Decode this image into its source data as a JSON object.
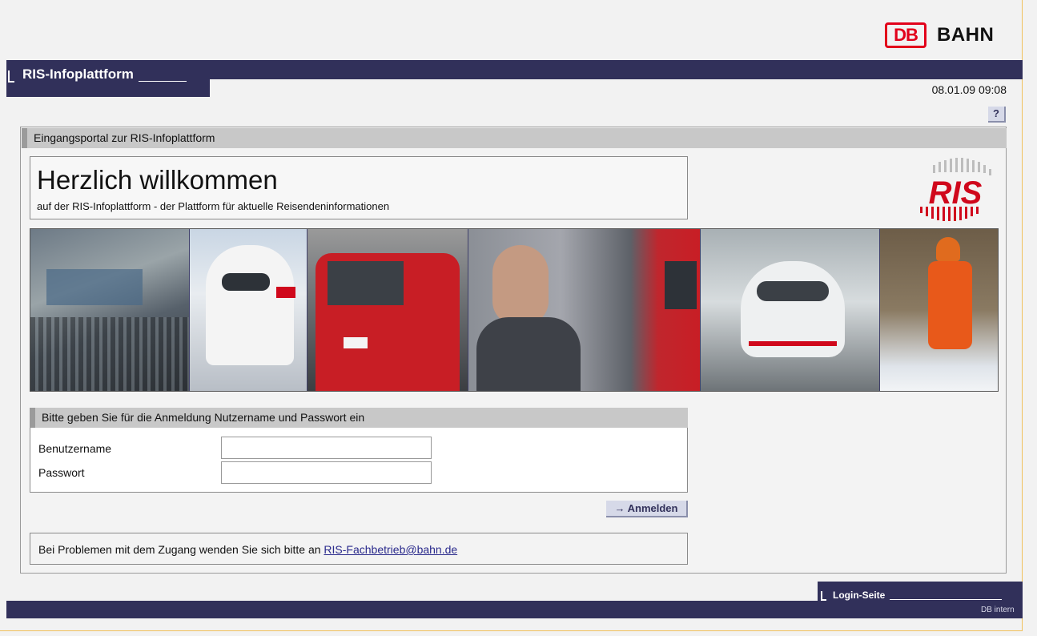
{
  "brand": {
    "logo_box": "DB",
    "logo_text": "BAHN",
    "logo_color": "#e2001a"
  },
  "header": {
    "app_title": "RIS-Infoplattform",
    "datetime": "08.01.09 09:08",
    "help_label": "?",
    "bar_color": "#31305a"
  },
  "main": {
    "panel_title": "Eingangsportal zur RIS-Infoplattform",
    "welcome_heading": "Herzlich willkommen",
    "welcome_subtitle": "auf der RIS-Infoplattform - der Plattform für aktuelle Reisendeninformationen",
    "ris_logo_text": "RIS",
    "photos": [
      "control-room-photo",
      "ice-train-photo",
      "regional-train-photo",
      "traveler-photo",
      "ice-station-photo",
      "track-worker-photo"
    ]
  },
  "login": {
    "heading": "Bitte geben Sie für die Anmeldung Nutzername und Passwort ein",
    "username_label": "Benutzername",
    "username_value": "",
    "password_label": "Passwort",
    "password_value": "",
    "submit_label": "→ Anmelden"
  },
  "help": {
    "text": "Bei Problemen mit dem Zugang wenden Sie sich bitte an ",
    "email": "RIS-Fachbetrieb@bahn.de"
  },
  "footer": {
    "page_label": "Login-Seite",
    "classification": "DB intern"
  }
}
